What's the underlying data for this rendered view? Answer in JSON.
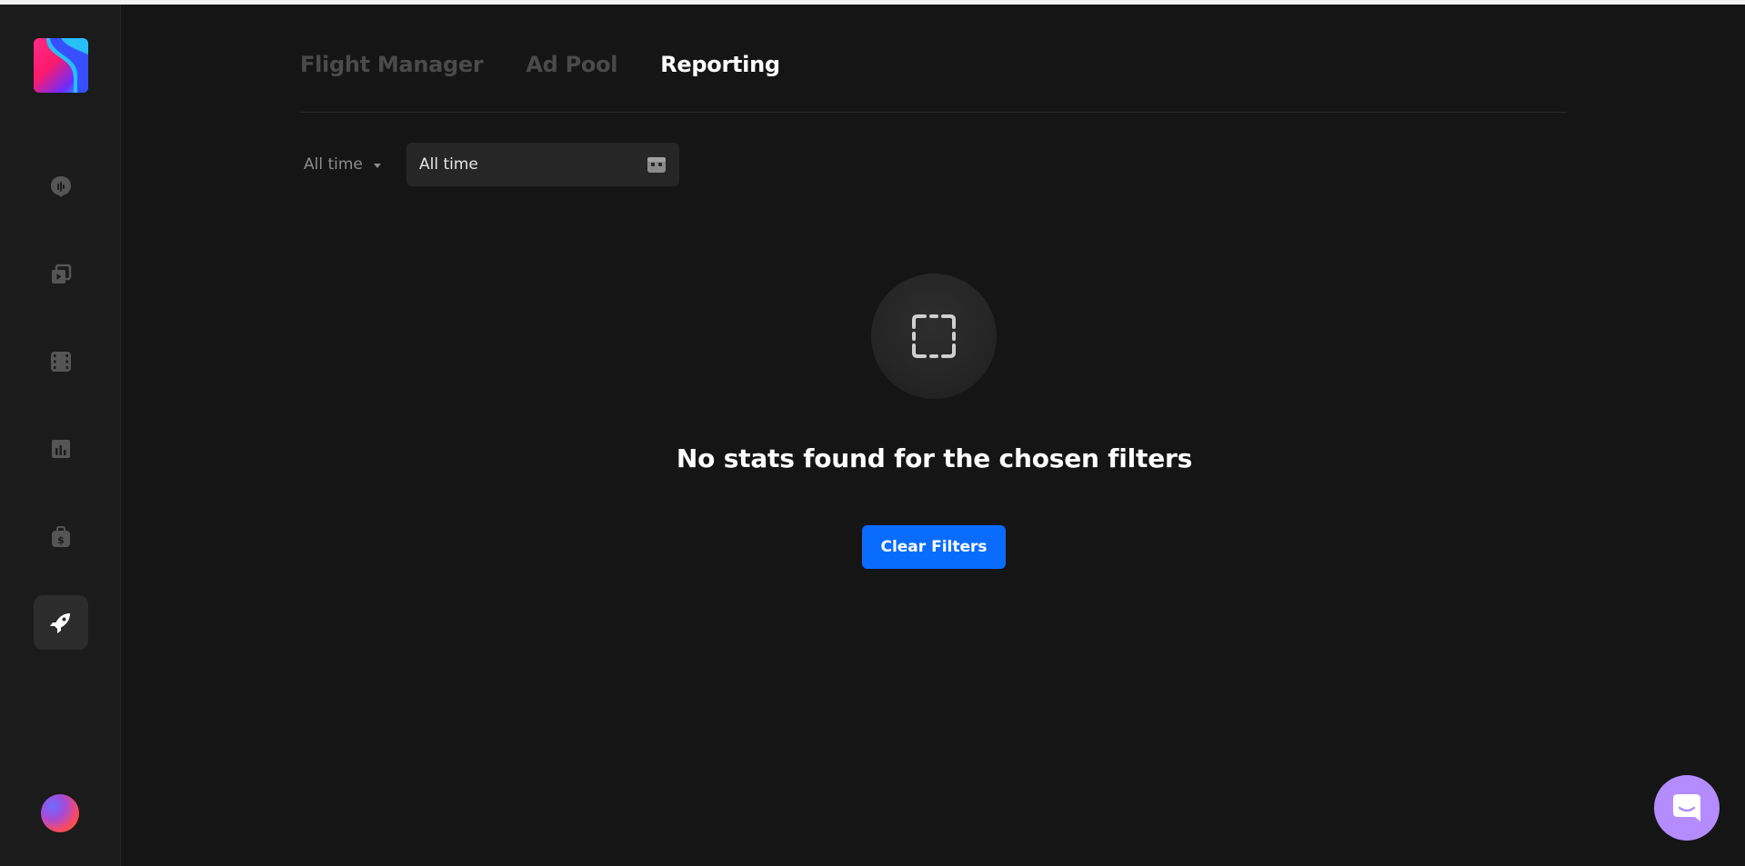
{
  "tabs": [
    {
      "label": "Flight Manager"
    },
    {
      "label": "Ad Pool"
    },
    {
      "label": "Reporting"
    }
  ],
  "filters": {
    "range_label": "All time",
    "date_value": "All time"
  },
  "empty_state": {
    "title": "No stats found for the chosen filters",
    "button_label": "Clear Filters"
  },
  "sidebar": {
    "icons": [
      "podcast-icon",
      "video-playlist-icon",
      "film-icon",
      "bar-chart-icon",
      "money-bag-icon",
      "rocket-icon"
    ],
    "active": "rocket-icon"
  },
  "colors": {
    "background": "#151515",
    "sidebar": "#1b1b1b",
    "accent_blue": "#0a6cff",
    "chat_purple": "#b48cff"
  }
}
